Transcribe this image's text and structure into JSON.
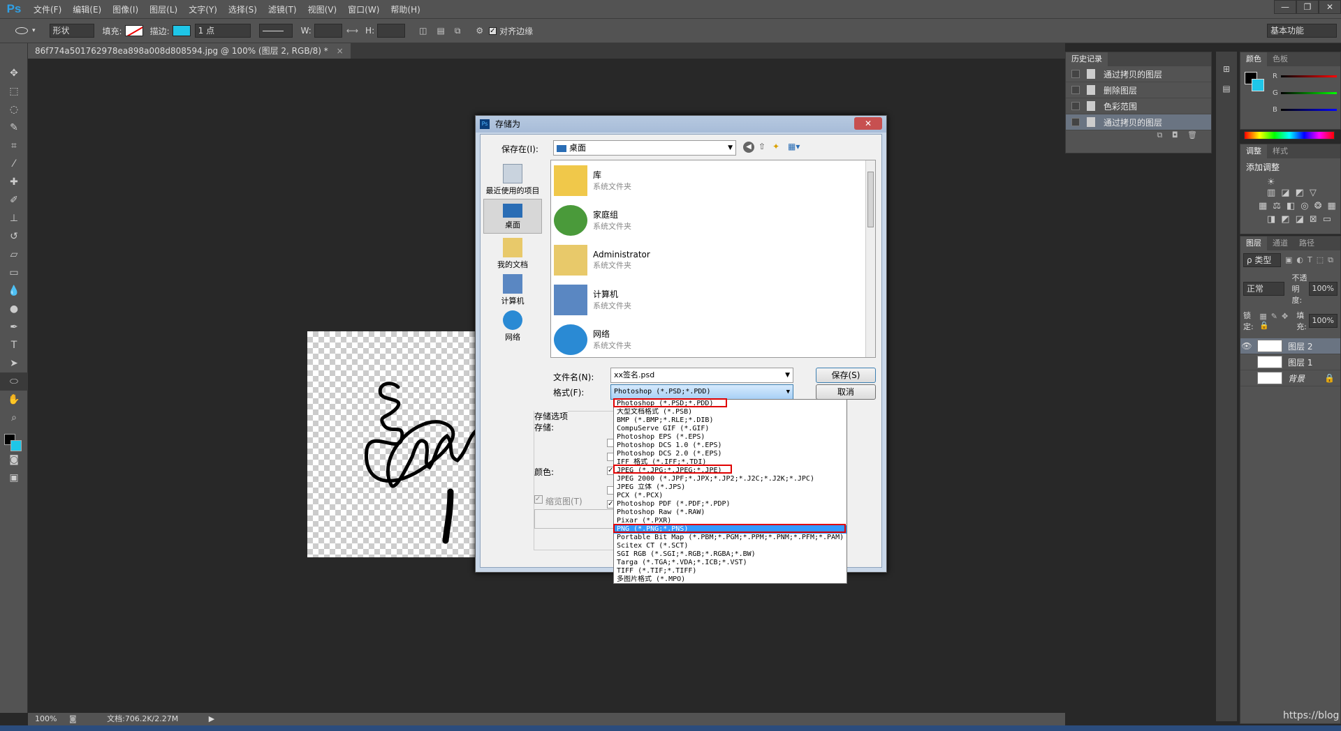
{
  "menubar": {
    "logo": "Ps",
    "items": [
      "文件(F)",
      "编辑(E)",
      "图像(I)",
      "图层(L)",
      "文字(Y)",
      "选择(S)",
      "滤镜(T)",
      "视图(V)",
      "窗口(W)",
      "帮助(H)"
    ],
    "window_controls": [
      "—",
      "❐",
      "✕"
    ]
  },
  "options": {
    "mode": "形状",
    "fill_label": "填充:",
    "stroke_label": "描边:",
    "stroke_width": "1 点",
    "w_label": "W:",
    "h_label": "H:",
    "align_edges": "对齐边缘",
    "workspace": "基本功能",
    "stroke_color": "#1fc6e8"
  },
  "document": {
    "tab_title": "86f774a501762978ea898a008d808594.jpg @ 100% (图层 2, RGB/8) *",
    "zoom": "100%",
    "doc_size": "文档:706.2K/2.27M"
  },
  "history": {
    "tabs": [
      "历史记录"
    ],
    "items": [
      "通过拷贝的图层",
      "删除图层",
      "色彩范围",
      "通过拷贝的图层"
    ]
  },
  "color_panel": {
    "tabs": [
      "颜色",
      "色板"
    ],
    "channels": [
      {
        "label": "R",
        "value": "0"
      },
      {
        "label": "G",
        "value": "0"
      },
      {
        "label": "B",
        "value": "0"
      }
    ]
  },
  "adjust_panel": {
    "tabs": [
      "调整",
      "样式"
    ],
    "title": "添加调整"
  },
  "layers_panel": {
    "tabs": [
      "图层",
      "通道",
      "路径"
    ],
    "filter": "ρ 类型",
    "blend_mode": "正常",
    "opacity_label": "不透明度:",
    "opacity": "100%",
    "lock_label": "锁定:",
    "fill_label": "填充:",
    "fill": "100%",
    "layers": [
      "图层 2",
      "图层 1",
      "背景"
    ]
  },
  "dialog": {
    "title": "存储为",
    "save_in_label": "保存在(I):",
    "save_in_value": "桌面",
    "nav": [
      "最近使用的项目",
      "桌面",
      "我的文档",
      "计算机",
      "网络"
    ],
    "files": [
      {
        "name": "库",
        "sub": "系统文件夹"
      },
      {
        "name": "家庭组",
        "sub": "系统文件夹"
      },
      {
        "name": "Administrator",
        "sub": "系统文件夹"
      },
      {
        "name": "计算机",
        "sub": "系统文件夹"
      },
      {
        "name": "网络",
        "sub": "系统文件夹"
      }
    ],
    "filename_label": "文件名(N):",
    "filename_value": "xx签名.psd",
    "format_label": "格式(F):",
    "format_value": "Photoshop (*.PSD;*.PDD)",
    "save_button": "保存(S)",
    "cancel_button": "取消",
    "save_options_title": "存储选项",
    "save_label": "存储:",
    "color_label": "颜色:",
    "thumbnail_label": "缩览图(T)"
  },
  "format_list": [
    "Photoshop (*.PSD;*.PDD)",
    "大型文档格式 (*.PSB)",
    "BMP (*.BMP;*.RLE;*.DIB)",
    "CompuServe GIF (*.GIF)",
    "Photoshop EPS (*.EPS)",
    "Photoshop DCS 1.0 (*.EPS)",
    "Photoshop DCS 2.0 (*.EPS)",
    "IFF 格式 (*.IFF;*.TDI)",
    "JPEG (*.JPG;*.JPEG;*.JPE)",
    "JPEG 2000 (*.JPF;*.JPX;*.JP2;*.J2C;*.J2K;*.JPC)",
    "JPEG 立体 (*.JPS)",
    "PCX (*.PCX)",
    "Photoshop PDF (*.PDF;*.PDP)",
    "Photoshop Raw (*.RAW)",
    "Pixar (*.PXR)",
    "PNG (*.PNG;*.PNS)",
    "Portable Bit Map (*.PBM;*.PGM;*.PPM;*.PNM;*.PFM;*.PAM)",
    "Scitex CT (*.SCT)",
    "SGI RGB (*.SGI;*.RGB;*.RGBA;*.BW)",
    "Targa (*.TGA;*.VDA;*.ICB;*.VST)",
    "TIFF (*.TIF;*.TIFF)",
    "多图片格式 (*.MPO)"
  ],
  "watermark": "https://blog"
}
